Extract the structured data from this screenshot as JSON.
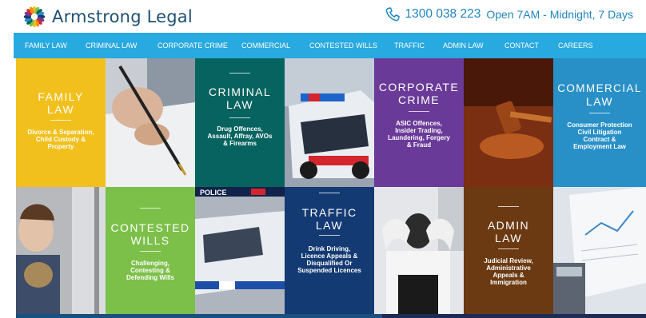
{
  "brand": {
    "name": "Armstrong Legal"
  },
  "contact": {
    "phone": "1300 038 223",
    "hours": "Open 7AM - Midnight, 7 Days"
  },
  "nav": {
    "items": [
      "FAMILY LAW",
      "CRIMINAL LAW",
      "CORPORATE CRIME",
      "COMMERCIAL",
      "CONTESTED WILLS",
      "TRAFFIC",
      "ADMIN LAW",
      "CONTACT",
      "CAREERS"
    ]
  },
  "tiles": {
    "family": {
      "title1": "FAMILY",
      "title2": "LAW",
      "desc": "Divorce & Separation, Child Custody & Property",
      "color": "#f2c01c"
    },
    "criminal": {
      "title1": "CRIMINAL",
      "title2": "LAW",
      "desc": "Drug Offences, Assault, Affray, AVOs & Firearms",
      "color": "#07635f"
    },
    "corporate": {
      "title1": "CORPORATE",
      "title2": "CRIME",
      "desc": "ASIC Offences, Insider Trading, Laundering, Forgery & Fraud",
      "color": "#6a3a98"
    },
    "commercial": {
      "title1": "COMMERCIAL",
      "title2": "LAW",
      "desc": "Consumer Protection Civil Litigation Contract & Employment Law",
      "color": "#2990c7"
    },
    "contested": {
      "title1": "CONTESTED",
      "title2": "WILLS",
      "desc": "Challenging, Contesting & Defending Wills",
      "color": "#7cc04a"
    },
    "traffic": {
      "title1": "TRAFFIC",
      "title2": "LAW",
      "desc": "Drink Driving, Licence Appeals & Disqualified Or Suspended Licences",
      "color": "#143a73"
    },
    "admin": {
      "title1": "ADMIN",
      "title2": "LAW",
      "desc": "Judicial Review, Administrative Appeals & Immigration",
      "color": "#6b3a12"
    }
  },
  "photos": {
    "police_sign": "POLICE"
  }
}
